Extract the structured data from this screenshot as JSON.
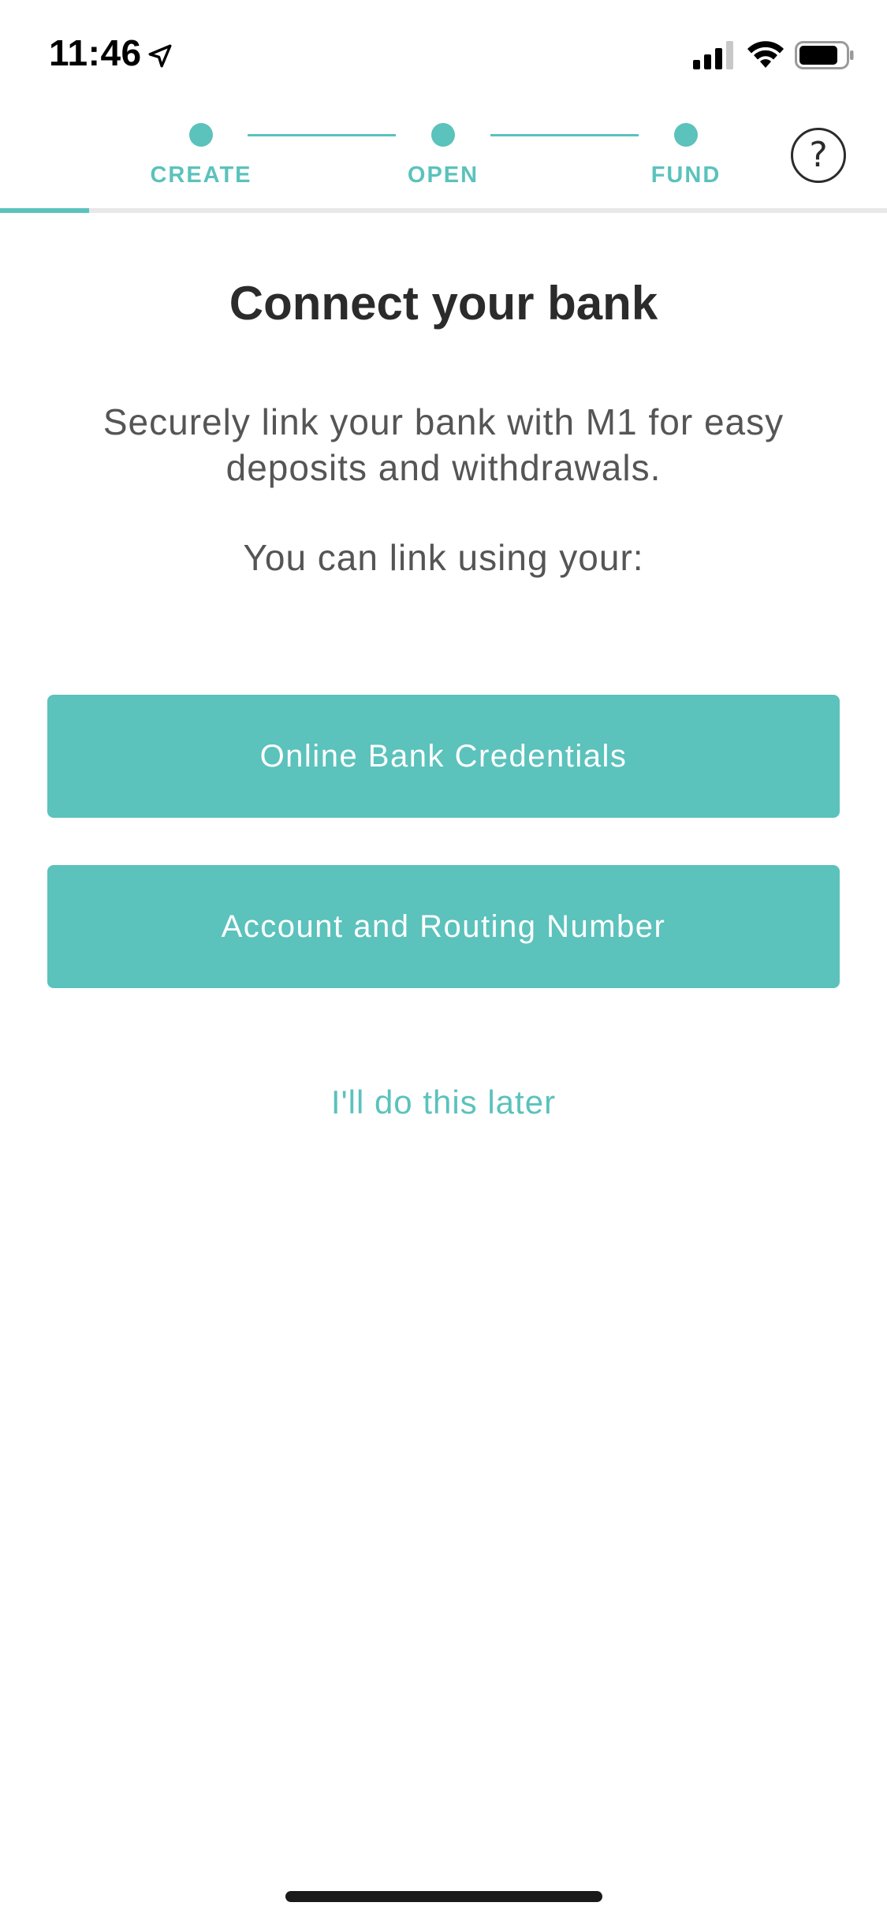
{
  "status_bar": {
    "time": "11:46",
    "icons": [
      "location-arrow-icon",
      "cellular-signal-icon",
      "wifi-icon",
      "battery-icon"
    ]
  },
  "stepper": {
    "steps": [
      {
        "label": "CREATE"
      },
      {
        "label": "OPEN"
      },
      {
        "label": "FUND"
      }
    ],
    "help_icon": "?",
    "progress_fraction": 0.1,
    "accent_color": "#5bc2bc"
  },
  "main": {
    "title": "Connect your bank",
    "description": "Securely link your bank with M1 for easy deposits and withdrawals.",
    "link_prompt": "You can link using your:",
    "buttons": {
      "online_credentials": "Online Bank Credentials",
      "account_routing": "Account and Routing Number"
    },
    "later_link": "I'll do this later"
  }
}
